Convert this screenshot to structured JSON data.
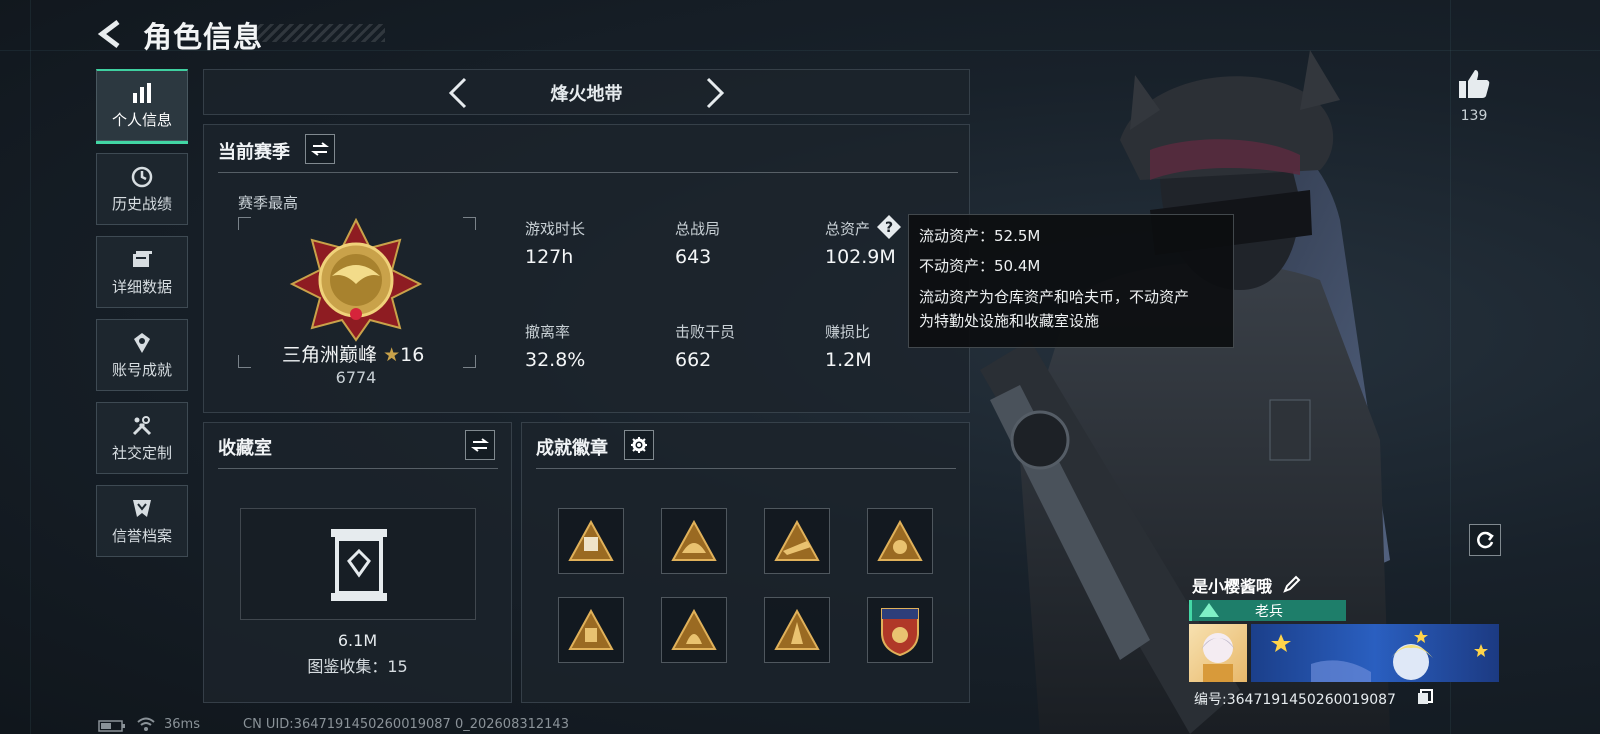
{
  "header": {
    "title": "角色信息"
  },
  "nav": {
    "items": [
      {
        "label": "个人信息",
        "icon": "bar-chart-icon"
      },
      {
        "label": "历史战绩",
        "icon": "history-clock-icon"
      },
      {
        "label": "详细数据",
        "icon": "folder-icon"
      },
      {
        "label": "账号成就",
        "icon": "medal-icon"
      },
      {
        "label": "社交定制",
        "icon": "tools-icon"
      },
      {
        "label": "信誉档案",
        "icon": "credit-shield-icon"
      }
    ]
  },
  "mode_selector": {
    "label": "烽火地带"
  },
  "season": {
    "title": "当前赛季",
    "best_label": "赛季最高",
    "rank_name": "三角洲巅峰",
    "rank_stars": "16",
    "rank_score": "6774",
    "stats": [
      {
        "label": "游戏时长",
        "value": "127h"
      },
      {
        "label": "总战局",
        "value": "643"
      },
      {
        "label": "总资产",
        "value": "102.9M"
      },
      {
        "label": "撤离率",
        "value": "32.8%"
      },
      {
        "label": "击败干员",
        "value": "662"
      },
      {
        "label": "赚损比",
        "value": "1.2M"
      }
    ]
  },
  "tooltip": {
    "line1": "流动资产：52.5M",
    "line2": "不动资产：50.4M",
    "line3": "流动资产为仓库资产和哈夫币，不动资产",
    "line4": "为特勤处设施和收藏室设施"
  },
  "collection": {
    "title": "收藏室",
    "value": "6.1M",
    "catalog": "图鉴收集：15"
  },
  "achievements": {
    "title": "成就徽章",
    "badges": [
      "badge-1",
      "badge-2",
      "badge-3",
      "badge-4",
      "badge-5",
      "badge-6",
      "badge-7",
      "badge-8"
    ]
  },
  "likes": {
    "count": "139"
  },
  "player": {
    "name": "是小樱酱哦",
    "title": "老兵",
    "uid_label": "编号:3647191450260019087"
  },
  "footer": {
    "ping": "36ms",
    "uid_text": "CN UID:3647191450260019087 0_202608312143"
  },
  "colors": {
    "accent": "#42d6a4",
    "gold": "#c9a24a",
    "rank_red": "#9e1f24"
  }
}
